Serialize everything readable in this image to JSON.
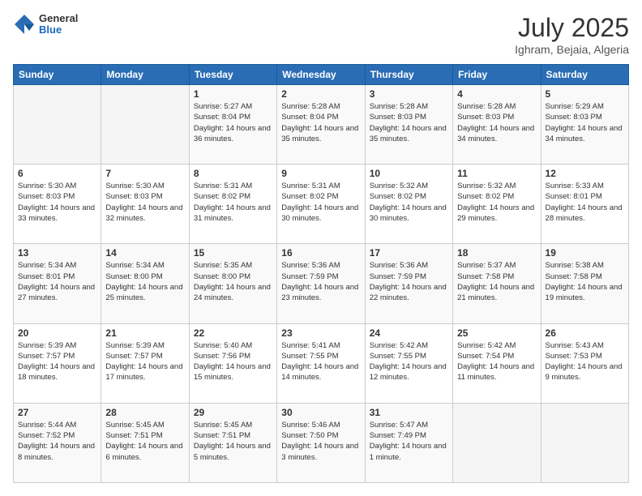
{
  "header": {
    "logo_general": "General",
    "logo_blue": "Blue",
    "month_title": "July 2025",
    "location": "Ighram, Bejaia, Algeria"
  },
  "days_of_week": [
    "Sunday",
    "Monday",
    "Tuesday",
    "Wednesday",
    "Thursday",
    "Friday",
    "Saturday"
  ],
  "weeks": [
    [
      {
        "day": "",
        "info": ""
      },
      {
        "day": "",
        "info": ""
      },
      {
        "day": "1",
        "info": "Sunrise: 5:27 AM\nSunset: 8:04 PM\nDaylight: 14 hours\nand 36 minutes."
      },
      {
        "day": "2",
        "info": "Sunrise: 5:28 AM\nSunset: 8:04 PM\nDaylight: 14 hours\nand 35 minutes."
      },
      {
        "day": "3",
        "info": "Sunrise: 5:28 AM\nSunset: 8:03 PM\nDaylight: 14 hours\nand 35 minutes."
      },
      {
        "day": "4",
        "info": "Sunrise: 5:28 AM\nSunset: 8:03 PM\nDaylight: 14 hours\nand 34 minutes."
      },
      {
        "day": "5",
        "info": "Sunrise: 5:29 AM\nSunset: 8:03 PM\nDaylight: 14 hours\nand 34 minutes."
      }
    ],
    [
      {
        "day": "6",
        "info": "Sunrise: 5:30 AM\nSunset: 8:03 PM\nDaylight: 14 hours\nand 33 minutes."
      },
      {
        "day": "7",
        "info": "Sunrise: 5:30 AM\nSunset: 8:03 PM\nDaylight: 14 hours\nand 32 minutes."
      },
      {
        "day": "8",
        "info": "Sunrise: 5:31 AM\nSunset: 8:02 PM\nDaylight: 14 hours\nand 31 minutes."
      },
      {
        "day": "9",
        "info": "Sunrise: 5:31 AM\nSunset: 8:02 PM\nDaylight: 14 hours\nand 30 minutes."
      },
      {
        "day": "10",
        "info": "Sunrise: 5:32 AM\nSunset: 8:02 PM\nDaylight: 14 hours\nand 30 minutes."
      },
      {
        "day": "11",
        "info": "Sunrise: 5:32 AM\nSunset: 8:02 PM\nDaylight: 14 hours\nand 29 minutes."
      },
      {
        "day": "12",
        "info": "Sunrise: 5:33 AM\nSunset: 8:01 PM\nDaylight: 14 hours\nand 28 minutes."
      }
    ],
    [
      {
        "day": "13",
        "info": "Sunrise: 5:34 AM\nSunset: 8:01 PM\nDaylight: 14 hours\nand 27 minutes."
      },
      {
        "day": "14",
        "info": "Sunrise: 5:34 AM\nSunset: 8:00 PM\nDaylight: 14 hours\nand 25 minutes."
      },
      {
        "day": "15",
        "info": "Sunrise: 5:35 AM\nSunset: 8:00 PM\nDaylight: 14 hours\nand 24 minutes."
      },
      {
        "day": "16",
        "info": "Sunrise: 5:36 AM\nSunset: 7:59 PM\nDaylight: 14 hours\nand 23 minutes."
      },
      {
        "day": "17",
        "info": "Sunrise: 5:36 AM\nSunset: 7:59 PM\nDaylight: 14 hours\nand 22 minutes."
      },
      {
        "day": "18",
        "info": "Sunrise: 5:37 AM\nSunset: 7:58 PM\nDaylight: 14 hours\nand 21 minutes."
      },
      {
        "day": "19",
        "info": "Sunrise: 5:38 AM\nSunset: 7:58 PM\nDaylight: 14 hours\nand 19 minutes."
      }
    ],
    [
      {
        "day": "20",
        "info": "Sunrise: 5:39 AM\nSunset: 7:57 PM\nDaylight: 14 hours\nand 18 minutes."
      },
      {
        "day": "21",
        "info": "Sunrise: 5:39 AM\nSunset: 7:57 PM\nDaylight: 14 hours\nand 17 minutes."
      },
      {
        "day": "22",
        "info": "Sunrise: 5:40 AM\nSunset: 7:56 PM\nDaylight: 14 hours\nand 15 minutes."
      },
      {
        "day": "23",
        "info": "Sunrise: 5:41 AM\nSunset: 7:55 PM\nDaylight: 14 hours\nand 14 minutes."
      },
      {
        "day": "24",
        "info": "Sunrise: 5:42 AM\nSunset: 7:55 PM\nDaylight: 14 hours\nand 12 minutes."
      },
      {
        "day": "25",
        "info": "Sunrise: 5:42 AM\nSunset: 7:54 PM\nDaylight: 14 hours\nand 11 minutes."
      },
      {
        "day": "26",
        "info": "Sunrise: 5:43 AM\nSunset: 7:53 PM\nDaylight: 14 hours\nand 9 minutes."
      }
    ],
    [
      {
        "day": "27",
        "info": "Sunrise: 5:44 AM\nSunset: 7:52 PM\nDaylight: 14 hours\nand 8 minutes."
      },
      {
        "day": "28",
        "info": "Sunrise: 5:45 AM\nSunset: 7:51 PM\nDaylight: 14 hours\nand 6 minutes."
      },
      {
        "day": "29",
        "info": "Sunrise: 5:45 AM\nSunset: 7:51 PM\nDaylight: 14 hours\nand 5 minutes."
      },
      {
        "day": "30",
        "info": "Sunrise: 5:46 AM\nSunset: 7:50 PM\nDaylight: 14 hours\nand 3 minutes."
      },
      {
        "day": "31",
        "info": "Sunrise: 5:47 AM\nSunset: 7:49 PM\nDaylight: 14 hours\nand 1 minute."
      },
      {
        "day": "",
        "info": ""
      },
      {
        "day": "",
        "info": ""
      }
    ]
  ]
}
